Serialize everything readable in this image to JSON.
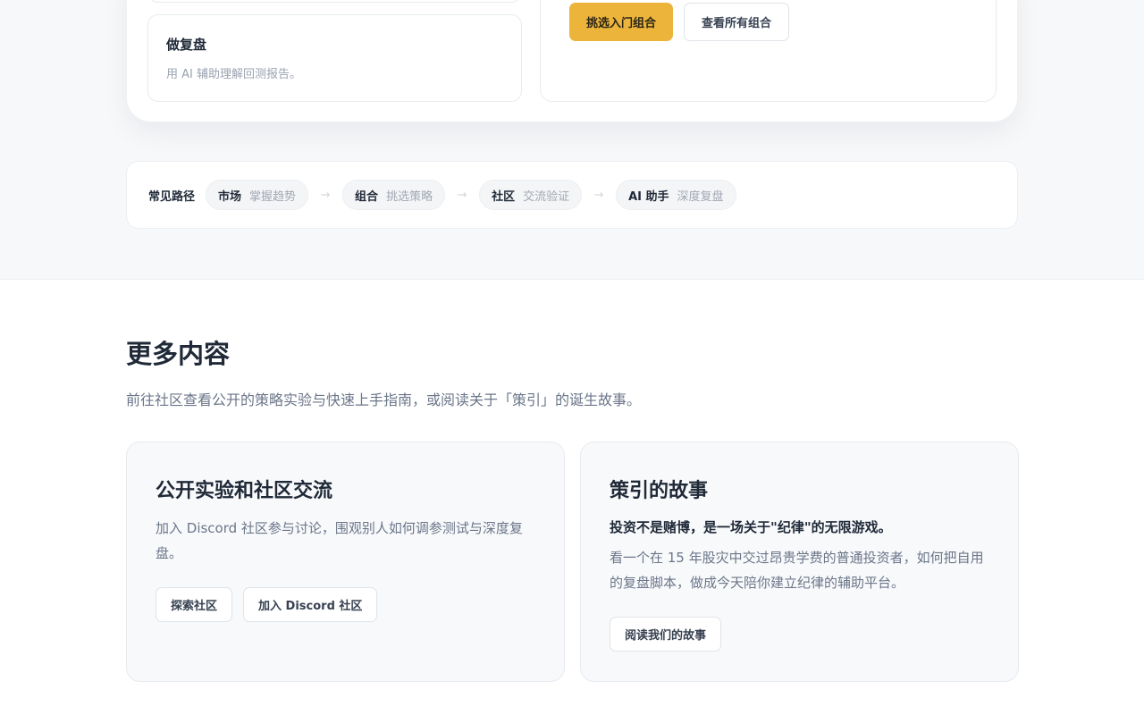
{
  "hero": {
    "mini_card": {
      "title": "做复盘",
      "description": "用 AI 辅助理解回测报告。"
    },
    "cta": {
      "primary_label": "挑选入门组合",
      "secondary_label": "查看所有组合"
    }
  },
  "common_paths": {
    "label": "常见路径",
    "steps": [
      {
        "title": "市场",
        "subtitle": "掌握趋势"
      },
      {
        "title": "组合",
        "subtitle": "挑选策略"
      },
      {
        "title": "社区",
        "subtitle": "交流验证"
      },
      {
        "title": "AI 助手",
        "subtitle": "深度复盘"
      }
    ],
    "arrow_icon": "arrow-right-icon"
  },
  "more": {
    "title": "更多内容",
    "description": "前往社区查看公开的策略实验与快速上手指南，或阅读关于「策引」的诞生故事。",
    "community_card": {
      "title": "公开实验和社区交流",
      "description": "加入 Discord 社区参与讨论，围观别人如何调参测试与深度复盘。",
      "buttons": [
        "探索社区",
        "加入 Discord 社区"
      ]
    },
    "story_card": {
      "title": "策引的故事",
      "tagline": "投资不是赌博，是一场关于\"纪律\"的无限游戏。",
      "description": "看一个在 15 年股灾中交过昂贵学费的普通投资者，如何把自用的复盘脚本，做成今天陪你建立纪律的辅助平台。",
      "button": "阅读我们的故事"
    }
  },
  "colors": {
    "accent": "#ecb43a",
    "page_band": "#f7f8fa",
    "text_primary": "#1f2937",
    "text_muted": "#6b7689"
  }
}
